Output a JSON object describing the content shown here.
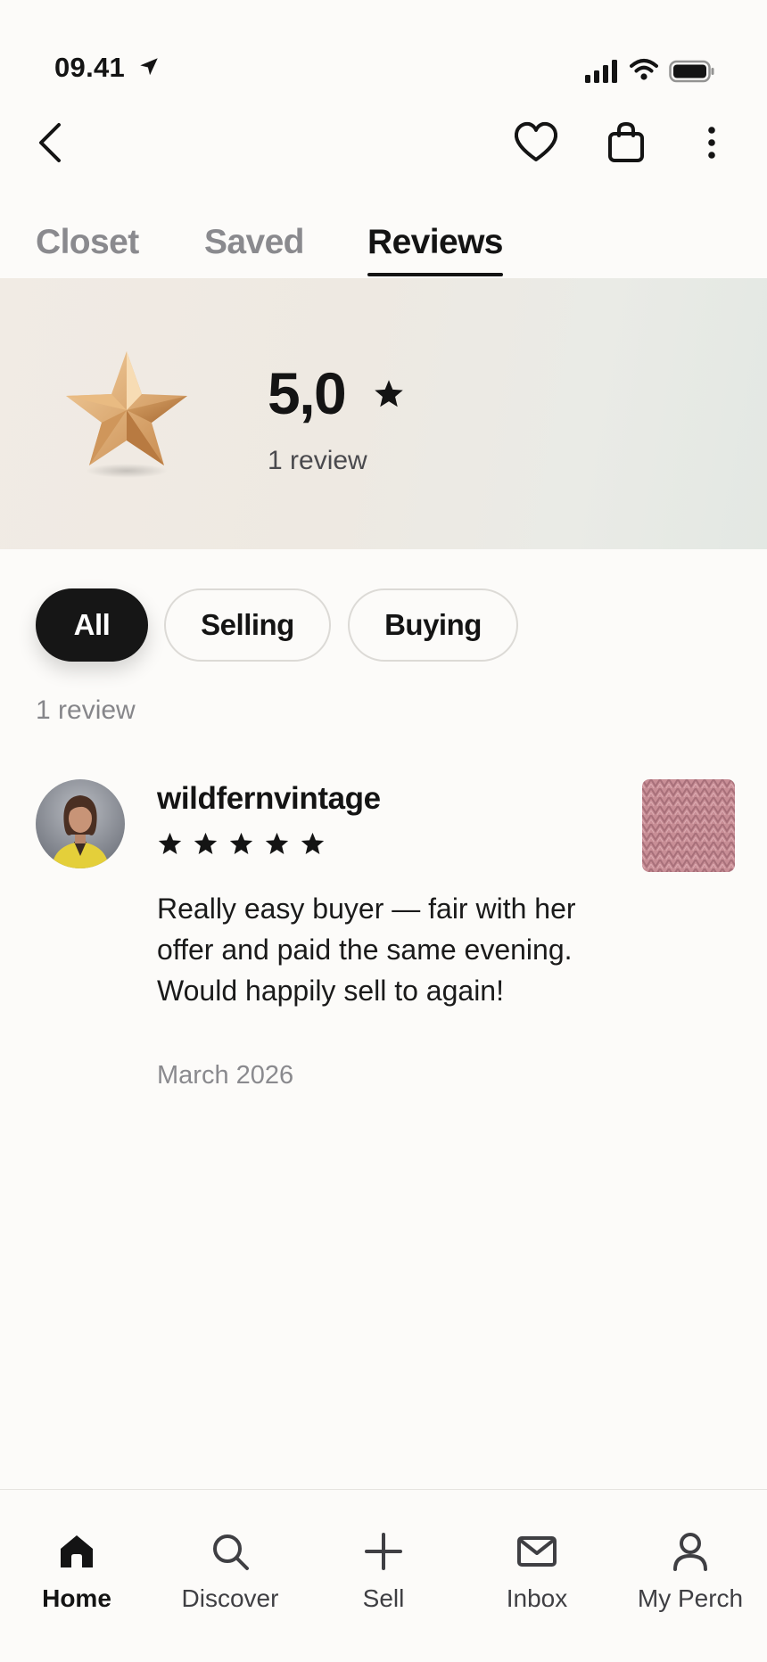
{
  "status_bar": {
    "time": "09.41",
    "icons": [
      "location-arrow-icon",
      "cellular-signal-icon",
      "wifi-icon",
      "battery-icon"
    ]
  },
  "top_nav": {
    "icons": [
      "back-chevron-icon",
      "heart-icon",
      "shopping-bag-icon",
      "more-vertical-icon"
    ]
  },
  "tabs": [
    {
      "label": "Closet",
      "active": false
    },
    {
      "label": "Saved",
      "active": false
    },
    {
      "label": "Reviews",
      "active": true
    }
  ],
  "rating_summary": {
    "value": "5,0",
    "count_label": "1 review",
    "icon": "gold-star-icon"
  },
  "filters": [
    {
      "label": "All",
      "active": true
    },
    {
      "label": "Selling",
      "active": false
    },
    {
      "label": "Buying",
      "active": false
    }
  ],
  "list": {
    "count_label": "1 review"
  },
  "reviews": [
    {
      "reviewer": "wildfernvintage",
      "rating": 5,
      "rating_max": 5,
      "text": "Really easy buyer — fair with her offer and paid the same evening. Would happily sell to again!",
      "date": "March 2026"
    }
  ],
  "bottom_nav": [
    {
      "label": "Home",
      "icon": "home-icon",
      "active": true
    },
    {
      "label": "Discover",
      "icon": "search-icon",
      "active": false
    },
    {
      "label": "Sell",
      "icon": "plus-icon",
      "active": false
    },
    {
      "label": "Inbox",
      "icon": "mail-icon",
      "active": false
    },
    {
      "label": "My Perch",
      "icon": "person-icon",
      "active": false
    }
  ],
  "colors": {
    "background": "#fcfbf9",
    "text_primary": "#141414",
    "text_muted": "#8a8a8e",
    "chip_active": "#161616",
    "hero_gold": "#c8925a"
  }
}
